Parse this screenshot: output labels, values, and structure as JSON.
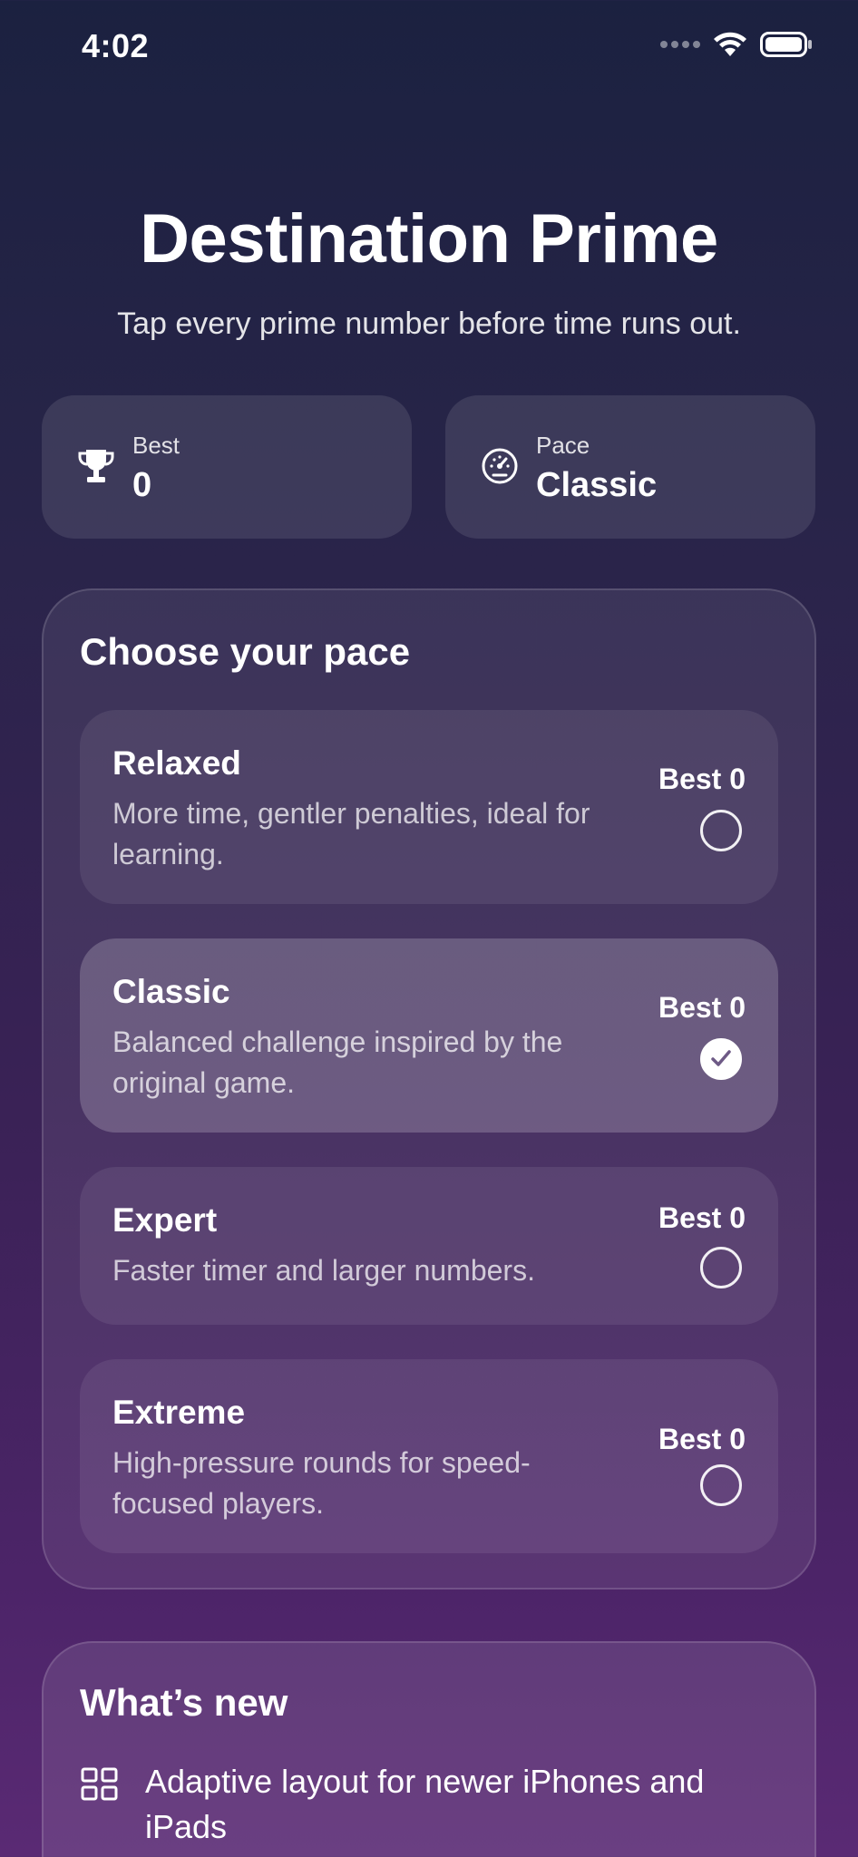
{
  "status_bar": {
    "time": "4:02",
    "icons": [
      "signal-dots-icon",
      "wifi-icon",
      "battery-icon"
    ]
  },
  "header": {
    "title": "Destination Prime",
    "subtitle": "Tap every prime number before time runs out."
  },
  "stats": {
    "best": {
      "label": "Best",
      "value": "0",
      "icon": "trophy-icon"
    },
    "pace": {
      "label": "Pace",
      "value": "Classic",
      "icon": "speedometer-icon"
    }
  },
  "pace_panel": {
    "title": "Choose your pace",
    "options": [
      {
        "name": "Relaxed",
        "description": "More time, gentler penalties, ideal for learning.",
        "best": "Best 0",
        "selected": false
      },
      {
        "name": "Classic",
        "description": "Balanced challenge inspired by the original game.",
        "best": "Best 0",
        "selected": true
      },
      {
        "name": "Expert",
        "description": "Faster timer and larger numbers.",
        "best": "Best 0",
        "selected": false
      },
      {
        "name": "Extreme",
        "description": "High-pressure rounds for speed-focused players.",
        "best": "Best 0",
        "selected": false
      }
    ]
  },
  "whats_new": {
    "title": "What’s new",
    "items": [
      {
        "icon": "grid-icon",
        "text": "Adaptive layout for newer iPhones and iPads"
      }
    ]
  },
  "colors": {
    "background_top": "#1b2140",
    "background_bottom": "#5a2a74",
    "text": "#ffffff"
  }
}
